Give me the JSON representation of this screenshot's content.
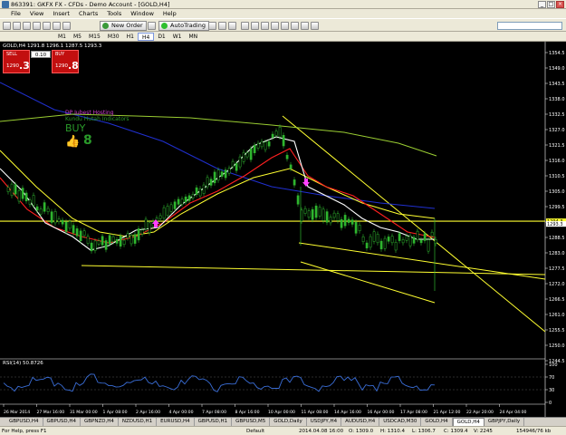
{
  "window": {
    "title": "863391: GKFX FX - CFDs - Demo Account - [GOLD,H4]"
  },
  "menu": [
    "File",
    "View",
    "Insert",
    "Charts",
    "Tools",
    "Window",
    "Help"
  ],
  "toolbar": {
    "new_order": "New Order",
    "autotrading": "AutoTrading"
  },
  "timeframes": [
    "M1",
    "M5",
    "M15",
    "M30",
    "H1",
    "H4",
    "D1",
    "W1",
    "MN"
  ],
  "active_timeframe": "H4",
  "chart": {
    "header": "GOLD,H4  1291.8 1296.1 1287.5 1293.3",
    "one_click": {
      "sell": "SELL",
      "buy": "BUY",
      "lot": "0.10",
      "sell_small": "1290",
      "sell_big": ".3",
      "buy_small": "1290",
      "buy_big": ".8"
    },
    "indicator_lines": [
      "DP Iubest Hosting",
      "Kundu Hutah Indicators"
    ],
    "signal": "BUY",
    "price_labels": [
      "1354.5",
      "1349.0",
      "1343.5",
      "1338.0",
      "1332.5",
      "1327.0",
      "1321.5",
      "1316.0",
      "1310.5",
      "1305.0",
      "1299.5",
      "1294.0",
      "1288.5",
      "1283.0",
      "1277.5",
      "1272.0",
      "1266.5",
      "1261.0",
      "1255.5",
      "1250.0",
      "1244.5"
    ],
    "current_price": "1293.3",
    "hline_price": "1294.3",
    "time_labels": [
      "26 Mar 2014",
      "27 Mar 16:00",
      "31 Mar 00:00",
      "1 Apr 08:00",
      "2 Apr 16:00",
      "4 Apr 00:00",
      "7 Apr 08:00",
      "8 Apr 16:00",
      "10 Apr 00:00",
      "11 Apr 08:00",
      "14 Apr 16:00",
      "16 Apr 00:00",
      "17 Apr 08:00",
      "21 Apr 12:00",
      "22 Apr 20:00",
      "24 Apr 04:00"
    ],
    "rsi_label": "RSI(14) 50.8726",
    "rsi_levels": [
      "100",
      "70",
      "30",
      "0"
    ]
  },
  "tabs": [
    "GBPUSD,H4",
    "GBPUSD,H4",
    "GBPNZD,H4",
    "NZDUSD,H1",
    "EURUSD,H4",
    "GBPUSD,H1",
    "GBPUSD,M5",
    "GOLD,Daily",
    "USDJPY,H4",
    "AUDUSD,H4",
    "USDCAD,M30",
    "GOLD,H4",
    "GOLD,H4",
    "GBPJPY,Daily"
  ],
  "active_tab_index": 12,
  "status": {
    "help": "For Help, press F1",
    "profile": "Default",
    "datetime": "2014.04.08 16:00",
    "open": "O: 1309.0",
    "high": "H: 1310.4",
    "low": "L: 1306.7",
    "close": "C: 1309.4",
    "volume": "V: 2245",
    "traffic": "154946/76 kb"
  },
  "colors": {
    "bg": "#000000",
    "candle": "#2fb52f",
    "white_ma": "#ffffff",
    "red_ma": "#ff2020",
    "yellow": "#ffff30",
    "blue_ma": "#2030d0",
    "green_ma": "#9acd32",
    "rsi": "#3a6ed8",
    "magenta": "#ff40ff"
  }
}
